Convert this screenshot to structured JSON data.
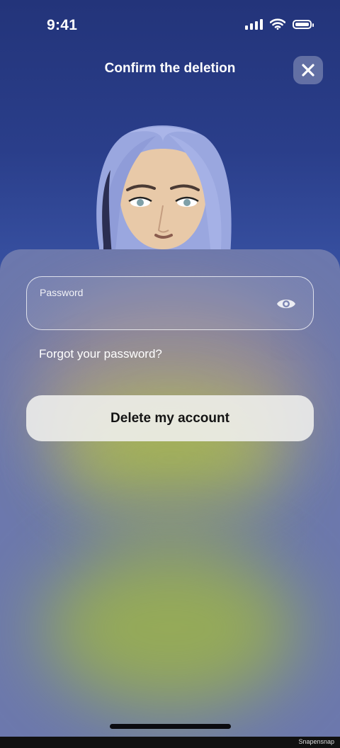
{
  "status_bar": {
    "time": "9:41"
  },
  "header": {
    "title": "Confirm the deletion",
    "close_icon": "close-icon"
  },
  "form": {
    "password_label": "Password",
    "password_value": "",
    "eye_icon": "eye-icon",
    "forgot_password": "Forgot your password?",
    "delete_button": "Delete my account"
  },
  "footer": {
    "watermark": "Snapensnap"
  },
  "colors": {
    "background_top": "#23347a",
    "background_bottom": "#5268b0",
    "button_bg": "#f0f0ee",
    "button_text": "#141414",
    "blob_green": "#a8c23a"
  }
}
